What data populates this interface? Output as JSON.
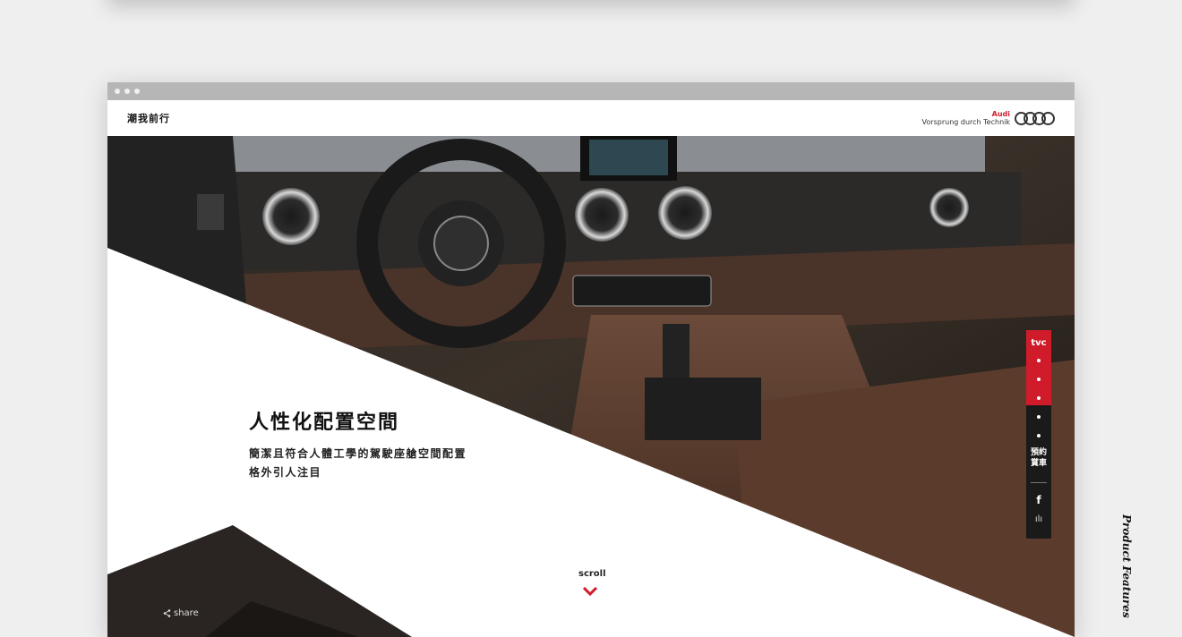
{
  "window": {
    "chrome_dots": 3
  },
  "header": {
    "site_title": "潮我前行",
    "brand_name": "Audi",
    "brand_slogan": "Vorsprung durch Technik"
  },
  "hero": {
    "headline": "人性化配置空間",
    "description_line1": "簡潔且符合人體工學的駕駛座艙空間配置",
    "description_line2": "格外引人注目",
    "scroll_label": "scroll",
    "share_label": "share"
  },
  "sidebar": {
    "tvc_label": "tvc",
    "book_label_line1": "預約",
    "book_label_line2": "賞車",
    "facebook_glyph": "f",
    "stats_glyph": "ılı"
  },
  "side_caption": "Product Features",
  "colors": {
    "accent": "#d01c2a",
    "sidebar_bg": "#1a1a1a",
    "background": "#efefef"
  },
  "icons": [
    "share-icon",
    "chevron-down-icon",
    "facebook-icon",
    "stats-icon",
    "audi-rings-logo"
  ]
}
